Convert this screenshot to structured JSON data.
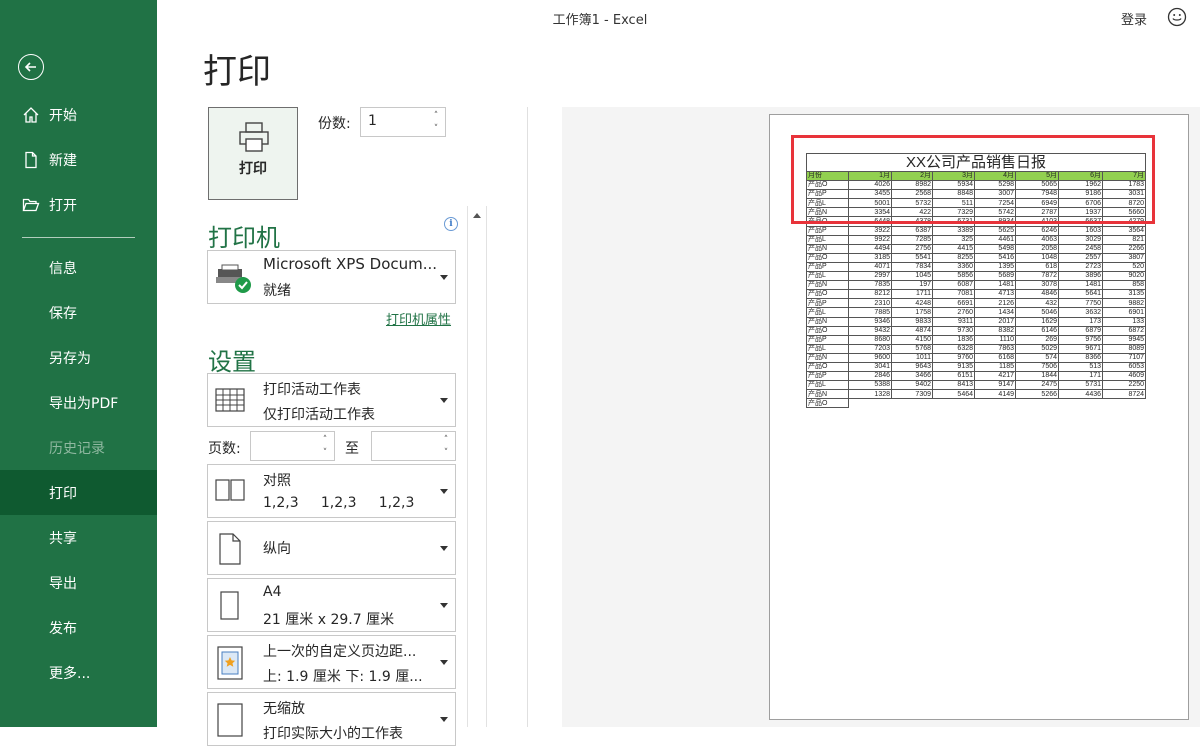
{
  "window": {
    "title": "工作簿1  -  Excel",
    "login": "登录"
  },
  "sidebar": {
    "items": [
      {
        "label": "开始",
        "icon": "home-icon"
      },
      {
        "label": "新建",
        "icon": "new-file-icon"
      },
      {
        "label": "打开",
        "icon": "folder-open-icon"
      },
      {
        "label": "信息"
      },
      {
        "label": "保存"
      },
      {
        "label": "另存为"
      },
      {
        "label": "导出为PDF"
      },
      {
        "label": "历史记录"
      },
      {
        "label": "打印"
      },
      {
        "label": "共享"
      },
      {
        "label": "导出"
      },
      {
        "label": "发布"
      },
      {
        "label": "更多..."
      }
    ]
  },
  "print": {
    "title": "打印",
    "button": "打印",
    "copies_label": "份数:",
    "copies": "1",
    "printer_section": "打印机",
    "printer_name": "Microsoft XPS Docum...",
    "printer_status": "就绪",
    "printer_props": "打印机属性",
    "settings_section": "设置",
    "pages_label": "页数:",
    "to_label": "至",
    "settings": [
      {
        "line1": "打印活动工作表",
        "line2": "仅打印活动工作表"
      },
      {
        "line1": "对照",
        "line2": "1,2,3     1,2,3     1,2,3"
      },
      {
        "line1": "纵向",
        "line2": ""
      },
      {
        "line1": "A4",
        "line2": "21 厘米 x 29.7 厘米"
      },
      {
        "line1": "上一次的自定义页边距...",
        "line2": "上: 1.9 厘米 下: 1.9 厘..."
      },
      {
        "line1": "无缩放",
        "line2": "打印实际大小的工作表"
      }
    ]
  },
  "preview": {
    "title": "XX公司产品销售日报",
    "headers": [
      "月份",
      "1月",
      "2月",
      "3月",
      "4月",
      "5月",
      "6月",
      "7月"
    ],
    "rows": [
      [
        "产品O",
        "4026",
        "8982",
        "5934",
        "5298",
        "5065",
        "1962",
        "1783"
      ],
      [
        "产品P",
        "3455",
        "2568",
        "8848",
        "3007",
        "7948",
        "9186",
        "3031"
      ],
      [
        "产品L",
        "5001",
        "5732",
        "511",
        "7254",
        "6949",
        "6706",
        "8720"
      ],
      [
        "产品N",
        "3354",
        "422",
        "7329",
        "5742",
        "2787",
        "1937",
        "5660"
      ],
      [
        "产品O",
        "6448",
        "4378",
        "6731",
        "8934",
        "4103",
        "6637",
        "4279"
      ],
      [
        "产品P",
        "3922",
        "6387",
        "3389",
        "5625",
        "6246",
        "1603",
        "3564"
      ],
      [
        "产品L",
        "9922",
        "7285",
        "325",
        "4461",
        "4063",
        "3029",
        "821"
      ],
      [
        "产品N",
        "4494",
        "2756",
        "4415",
        "5498",
        "2058",
        "2458",
        "2266"
      ],
      [
        "产品O",
        "3185",
        "5541",
        "8255",
        "5416",
        "1048",
        "2557",
        "3807"
      ],
      [
        "产品P",
        "4071",
        "7834",
        "3360",
        "1395",
        "618",
        "2723",
        "520"
      ],
      [
        "产品L",
        "2997",
        "1045",
        "5856",
        "5689",
        "7872",
        "3896",
        "9020"
      ],
      [
        "产品N",
        "7835",
        "197",
        "6087",
        "1481",
        "3078",
        "1481",
        "858"
      ],
      [
        "产品O",
        "8212",
        "1711",
        "7081",
        "4713",
        "4846",
        "5641",
        "3135"
      ],
      [
        "产品P",
        "2310",
        "4248",
        "6691",
        "2126",
        "432",
        "7750",
        "9882"
      ],
      [
        "产品L",
        "7885",
        "1758",
        "2760",
        "1434",
        "5046",
        "3632",
        "6901"
      ],
      [
        "产品N",
        "9346",
        "9833",
        "9311",
        "2017",
        "1629",
        "173",
        "133"
      ],
      [
        "产品O",
        "9432",
        "4874",
        "9730",
        "8382",
        "6146",
        "6879",
        "6872"
      ],
      [
        "产品P",
        "8680",
        "4150",
        "1836",
        "1110",
        "269",
        "9756",
        "9945"
      ],
      [
        "产品L",
        "7203",
        "5768",
        "6328",
        "7863",
        "5029",
        "9671",
        "8089"
      ],
      [
        "产品N",
        "9600",
        "1011",
        "9760",
        "6168",
        "574",
        "8366",
        "7107"
      ],
      [
        "产品O",
        "3041",
        "9643",
        "9135",
        "1185",
        "7506",
        "513",
        "6053"
      ],
      [
        "产品P",
        "2846",
        "3466",
        "6151",
        "4217",
        "1844",
        "171",
        "4609"
      ],
      [
        "产品L",
        "5388",
        "9402",
        "8413",
        "9147",
        "2475",
        "5731",
        "2250"
      ],
      [
        "产品N",
        "1328",
        "7309",
        "5464",
        "4149",
        "5266",
        "4436",
        "8724"
      ],
      [
        "产品O",
        "",
        "",
        "",
        "",
        "",
        "",
        ""
      ]
    ]
  },
  "colors": {
    "sidebar": "#207245",
    "sidebar_active": "#0f5a30",
    "accent": "#217346",
    "header_fill": "#92d050",
    "highlight": "#e8333a"
  }
}
